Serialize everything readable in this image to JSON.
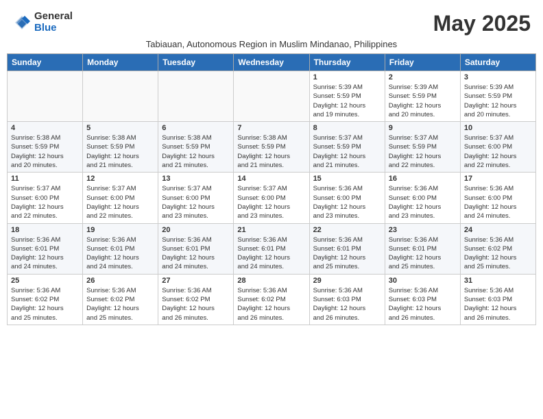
{
  "logo": {
    "general": "General",
    "blue": "Blue"
  },
  "title": "May 2025",
  "subtitle": "Tabiauan, Autonomous Region in Muslim Mindanao, Philippines",
  "days_of_week": [
    "Sunday",
    "Monday",
    "Tuesday",
    "Wednesday",
    "Thursday",
    "Friday",
    "Saturday"
  ],
  "weeks": [
    {
      "days": [
        {
          "number": "",
          "info": ""
        },
        {
          "number": "",
          "info": ""
        },
        {
          "number": "",
          "info": ""
        },
        {
          "number": "",
          "info": ""
        },
        {
          "number": "1",
          "info": "Sunrise: 5:39 AM\nSunset: 5:59 PM\nDaylight: 12 hours\nand 19 minutes."
        },
        {
          "number": "2",
          "info": "Sunrise: 5:39 AM\nSunset: 5:59 PM\nDaylight: 12 hours\nand 20 minutes."
        },
        {
          "number": "3",
          "info": "Sunrise: 5:39 AM\nSunset: 5:59 PM\nDaylight: 12 hours\nand 20 minutes."
        }
      ]
    },
    {
      "days": [
        {
          "number": "4",
          "info": "Sunrise: 5:38 AM\nSunset: 5:59 PM\nDaylight: 12 hours\nand 20 minutes."
        },
        {
          "number": "5",
          "info": "Sunrise: 5:38 AM\nSunset: 5:59 PM\nDaylight: 12 hours\nand 21 minutes."
        },
        {
          "number": "6",
          "info": "Sunrise: 5:38 AM\nSunset: 5:59 PM\nDaylight: 12 hours\nand 21 minutes."
        },
        {
          "number": "7",
          "info": "Sunrise: 5:38 AM\nSunset: 5:59 PM\nDaylight: 12 hours\nand 21 minutes."
        },
        {
          "number": "8",
          "info": "Sunrise: 5:37 AM\nSunset: 5:59 PM\nDaylight: 12 hours\nand 21 minutes."
        },
        {
          "number": "9",
          "info": "Sunrise: 5:37 AM\nSunset: 5:59 PM\nDaylight: 12 hours\nand 22 minutes."
        },
        {
          "number": "10",
          "info": "Sunrise: 5:37 AM\nSunset: 6:00 PM\nDaylight: 12 hours\nand 22 minutes."
        }
      ]
    },
    {
      "days": [
        {
          "number": "11",
          "info": "Sunrise: 5:37 AM\nSunset: 6:00 PM\nDaylight: 12 hours\nand 22 minutes."
        },
        {
          "number": "12",
          "info": "Sunrise: 5:37 AM\nSunset: 6:00 PM\nDaylight: 12 hours\nand 22 minutes."
        },
        {
          "number": "13",
          "info": "Sunrise: 5:37 AM\nSunset: 6:00 PM\nDaylight: 12 hours\nand 23 minutes."
        },
        {
          "number": "14",
          "info": "Sunrise: 5:37 AM\nSunset: 6:00 PM\nDaylight: 12 hours\nand 23 minutes."
        },
        {
          "number": "15",
          "info": "Sunrise: 5:36 AM\nSunset: 6:00 PM\nDaylight: 12 hours\nand 23 minutes."
        },
        {
          "number": "16",
          "info": "Sunrise: 5:36 AM\nSunset: 6:00 PM\nDaylight: 12 hours\nand 23 minutes."
        },
        {
          "number": "17",
          "info": "Sunrise: 5:36 AM\nSunset: 6:00 PM\nDaylight: 12 hours\nand 24 minutes."
        }
      ]
    },
    {
      "days": [
        {
          "number": "18",
          "info": "Sunrise: 5:36 AM\nSunset: 6:01 PM\nDaylight: 12 hours\nand 24 minutes."
        },
        {
          "number": "19",
          "info": "Sunrise: 5:36 AM\nSunset: 6:01 PM\nDaylight: 12 hours\nand 24 minutes."
        },
        {
          "number": "20",
          "info": "Sunrise: 5:36 AM\nSunset: 6:01 PM\nDaylight: 12 hours\nand 24 minutes."
        },
        {
          "number": "21",
          "info": "Sunrise: 5:36 AM\nSunset: 6:01 PM\nDaylight: 12 hours\nand 24 minutes."
        },
        {
          "number": "22",
          "info": "Sunrise: 5:36 AM\nSunset: 6:01 PM\nDaylight: 12 hours\nand 25 minutes."
        },
        {
          "number": "23",
          "info": "Sunrise: 5:36 AM\nSunset: 6:01 PM\nDaylight: 12 hours\nand 25 minutes."
        },
        {
          "number": "24",
          "info": "Sunrise: 5:36 AM\nSunset: 6:02 PM\nDaylight: 12 hours\nand 25 minutes."
        }
      ]
    },
    {
      "days": [
        {
          "number": "25",
          "info": "Sunrise: 5:36 AM\nSunset: 6:02 PM\nDaylight: 12 hours\nand 25 minutes."
        },
        {
          "number": "26",
          "info": "Sunrise: 5:36 AM\nSunset: 6:02 PM\nDaylight: 12 hours\nand 25 minutes."
        },
        {
          "number": "27",
          "info": "Sunrise: 5:36 AM\nSunset: 6:02 PM\nDaylight: 12 hours\nand 26 minutes."
        },
        {
          "number": "28",
          "info": "Sunrise: 5:36 AM\nSunset: 6:02 PM\nDaylight: 12 hours\nand 26 minutes."
        },
        {
          "number": "29",
          "info": "Sunrise: 5:36 AM\nSunset: 6:03 PM\nDaylight: 12 hours\nand 26 minutes."
        },
        {
          "number": "30",
          "info": "Sunrise: 5:36 AM\nSunset: 6:03 PM\nDaylight: 12 hours\nand 26 minutes."
        },
        {
          "number": "31",
          "info": "Sunrise: 5:36 AM\nSunset: 6:03 PM\nDaylight: 12 hours\nand 26 minutes."
        }
      ]
    }
  ]
}
